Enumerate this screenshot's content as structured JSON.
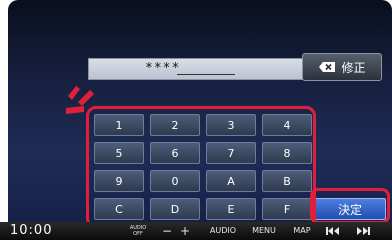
{
  "screen": {
    "pin_value": "****",
    "correct_label": "修正",
    "enter_label": "決定"
  },
  "keypad": {
    "keys": [
      "1",
      "2",
      "3",
      "4",
      "5",
      "6",
      "7",
      "8",
      "9",
      "0",
      "A",
      "B",
      "C",
      "D",
      "E",
      "F"
    ]
  },
  "bottom_bar": {
    "clock": "10:00",
    "audio_off_top": "AUDIO",
    "audio_off_bottom": "OFF",
    "minus_label": "−",
    "plus_label": "+",
    "audio_label": "AUDIO",
    "menu_label": "MENU",
    "map_label": "MAP"
  },
  "icons": {
    "correct": "backspace-icon",
    "prev": "prev-track-icon",
    "next": "next-track-icon",
    "callout": "attention-marks"
  },
  "colors": {
    "highlight": "#e0203a",
    "enter_button": "#2e5fc4",
    "key": "#3d4b63"
  }
}
